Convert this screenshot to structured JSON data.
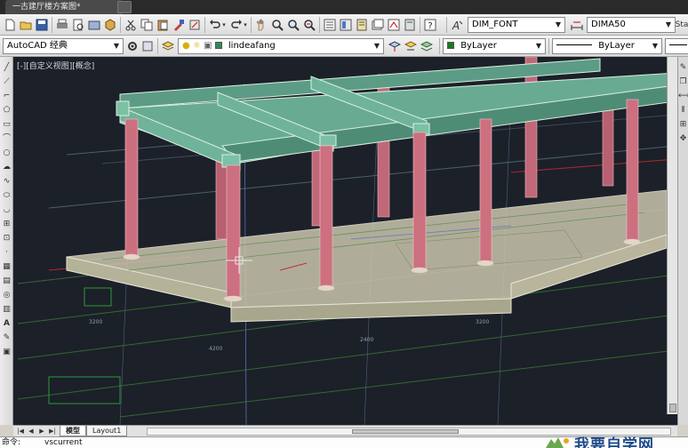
{
  "tabs": {
    "document": "一古建厅楼方案图*"
  },
  "toolbar1": {
    "text_style": "DIM_FONT",
    "dim_style": "DIMA50",
    "partial_right": "Sta"
  },
  "toolbar2": {
    "workspace": "AutoCAD 经典",
    "layer": "lindeafang",
    "color": "ByLayer",
    "linetype": "ByLayer"
  },
  "colors": {
    "layer_swatch": "#2e8b57",
    "color_swatch": "#1a7a1a",
    "background": "#1c2029",
    "beam": "#5fa38a",
    "column": "#d07080",
    "slab": "#c8c4a8"
  },
  "viewport": {
    "view_label": "[-][自定义视图][概念]"
  },
  "layout_tabs": [
    "模型",
    "Layout1"
  ],
  "command": {
    "prompt": "命令:",
    "current": "vscurrent"
  },
  "watermark": {
    "text": "我要自学网"
  },
  "icons": [
    "new-icon",
    "open-icon",
    "save-icon",
    "print-icon",
    "cut-icon",
    "copy-icon",
    "paste-icon",
    "undo-icon",
    "redo-icon",
    "pan-icon",
    "zoom-icon",
    "help-icon"
  ]
}
